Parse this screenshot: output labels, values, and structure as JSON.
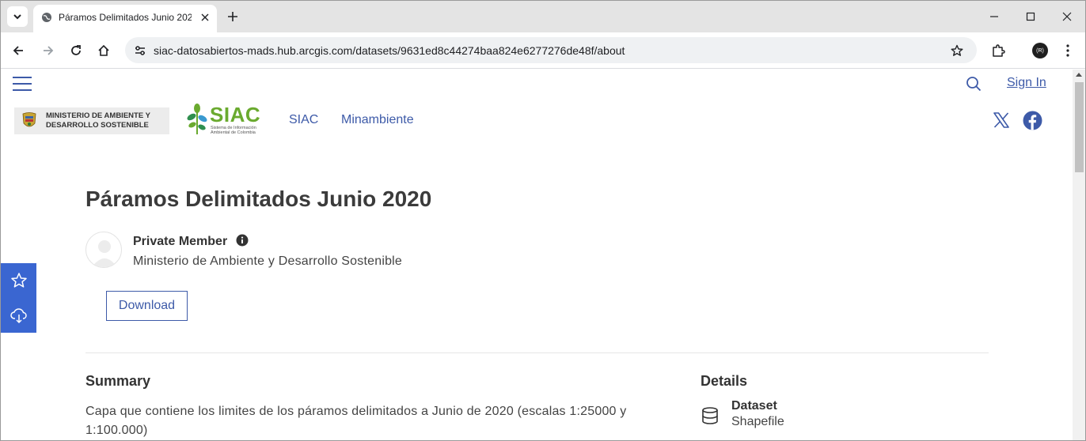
{
  "browser": {
    "tab_title": "Páramos Delimitados Junio 202",
    "url": "siac-datosabiertos-mads.hub.arcgis.com/datasets/9631ed8c44274baa824e6277276de48f/about",
    "profile_initial": "(R)"
  },
  "header": {
    "signin_label": "Sign In",
    "ministry_logo_text": [
      "MINISTERIO DE AMBIENTE Y",
      "DESARROLLO SOSTENIBLE"
    ],
    "siac_logo_word": "SIAC",
    "siac_logo_sub": "Sistema de Información Ambiental de Colombia",
    "nav": [
      {
        "label": "SIAC"
      },
      {
        "label": "Minambiente"
      }
    ]
  },
  "content": {
    "title": "Páramos Delimitados Junio 2020",
    "owner_name": "Private Member",
    "organization": "Ministerio de Ambiente y Desarrollo Sostenible",
    "download_label": "Download",
    "summary_heading": "Summary",
    "summary_text": "Capa que contiene los limites de los páramos delimitados a Junio de 2020 (escalas 1:25000 y 1:100.000)",
    "details_heading": "Details",
    "detail_type_label": "Dataset",
    "detail_type_value": "Shapefile"
  },
  "colors": {
    "accent": "#3d5aa8",
    "side_panel": "#3a66d1",
    "siac_green": "#6aaa2f"
  }
}
